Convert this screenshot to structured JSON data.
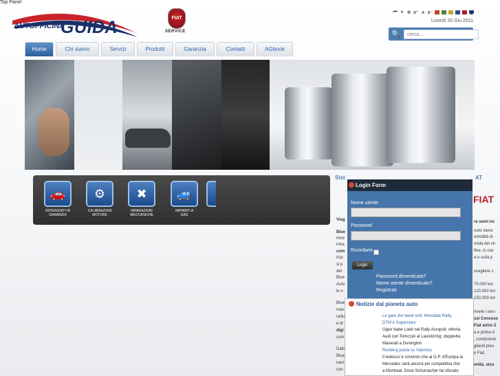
{
  "top_panel": "Top Panel",
  "logo": {
    "line1": "AUTOFFICINA",
    "line2": "GUIDA"
  },
  "fiat_badge": {
    "brand": "FIAT",
    "service": "SERVICE"
  },
  "toolbar": {
    "items": [
      "⏮",
      "⏸",
      "⊕",
      "a⁺",
      "a",
      "a⁻"
    ],
    "swatches": [
      "#b8462a",
      "#4f7f2f",
      "#c2a733",
      "#2a4f8a",
      "#b21e2a"
    ]
  },
  "date": "Lunedì 20 Giu 2011",
  "search": {
    "placeholder": "cerca..."
  },
  "nav": [
    {
      "label": "Home",
      "width": 40
    },
    {
      "label": "Chi siamo",
      "width": 61
    },
    {
      "label": "Servizi",
      "width": 47
    },
    {
      "label": "Prodotti",
      "width": 51
    },
    {
      "label": "Garanzia",
      "width": 55
    },
    {
      "label": "Contatti",
      "width": 53
    },
    {
      "label": "AGbook",
      "width": 51
    }
  ],
  "icons": [
    {
      "glyph": "🚗",
      "label1": "INTERVENTI IN",
      "label2": "GARANZIA",
      "icon": "car-wrench-icon"
    },
    {
      "glyph": "⚙",
      "label1": "CALIBRAZIONI",
      "label2": "MOTORE",
      "icon": "gears-icon"
    },
    {
      "glyph": "✖",
      "label1": "RIPARAZIONI",
      "label2": "MECCANICHE",
      "icon": "tools-icon"
    },
    {
      "glyph": "🚙",
      "label1": "IMPIANTI A",
      "label2": "GAS",
      "icon": "gas-car-icon"
    }
  ],
  "left_col": {
    "heading": "Sist",
    "lines": [
      "Viag",
      "Blue",
      "mod",
      "intra",
      "com",
      "risp",
      "si p",
      "del",
      "Blue",
      "Auto",
      "le n",
      "Blue",
      "mas",
      "cellu",
      "e di",
      "digi",
      "com",
      "Dalla",
      "Blue",
      "navi",
      "con"
    ]
  },
  "login": {
    "title": "Login Form",
    "username_label": "Nome utente",
    "password_label": "Password",
    "remember_label": "Ricordami",
    "button": "Login",
    "links": [
      "Password dimenticata?",
      "Nome utente dimenticato?",
      "Registrati"
    ]
  },
  "news": {
    "title": "Notizie dal pianeta auto",
    "lines": [
      "Le gare del week end: Mondiale Rally,",
      "DTM e Superstars",
      "Ogier batte Loeb nel Rally Acropoli; vittoria",
      "Audi con Tomczyk al Lausitzring; doppietta",
      "Maserati a Donington",
      "Rosberg punta su Valencia",
      "Il tedesco è convinto che al G.P. d'Europa la",
      "Mercedes sarà ancora più competitiva che",
      "a Montreal. Dove Schumacher ha sfiorato"
    ]
  },
  "right_col": {
    "heading": "AT",
    "fiat": "FIAT",
    "lines": [
      "re semi no",
      "nuto viene",
      "omodità di",
      "onda del ch",
      "fine, in cas",
      "a e sulla p",
      "scegliere s",
      "75.000 km",
      "120.000 km",
      "150.000 km",
      "rivere i serv",
      "ssi Concess",
      "Fiat entro 2",
      "a e prima d",
      ", condizione",
      "gliardi prev",
      "e Fiat.",
      "enità, sicu"
    ]
  }
}
